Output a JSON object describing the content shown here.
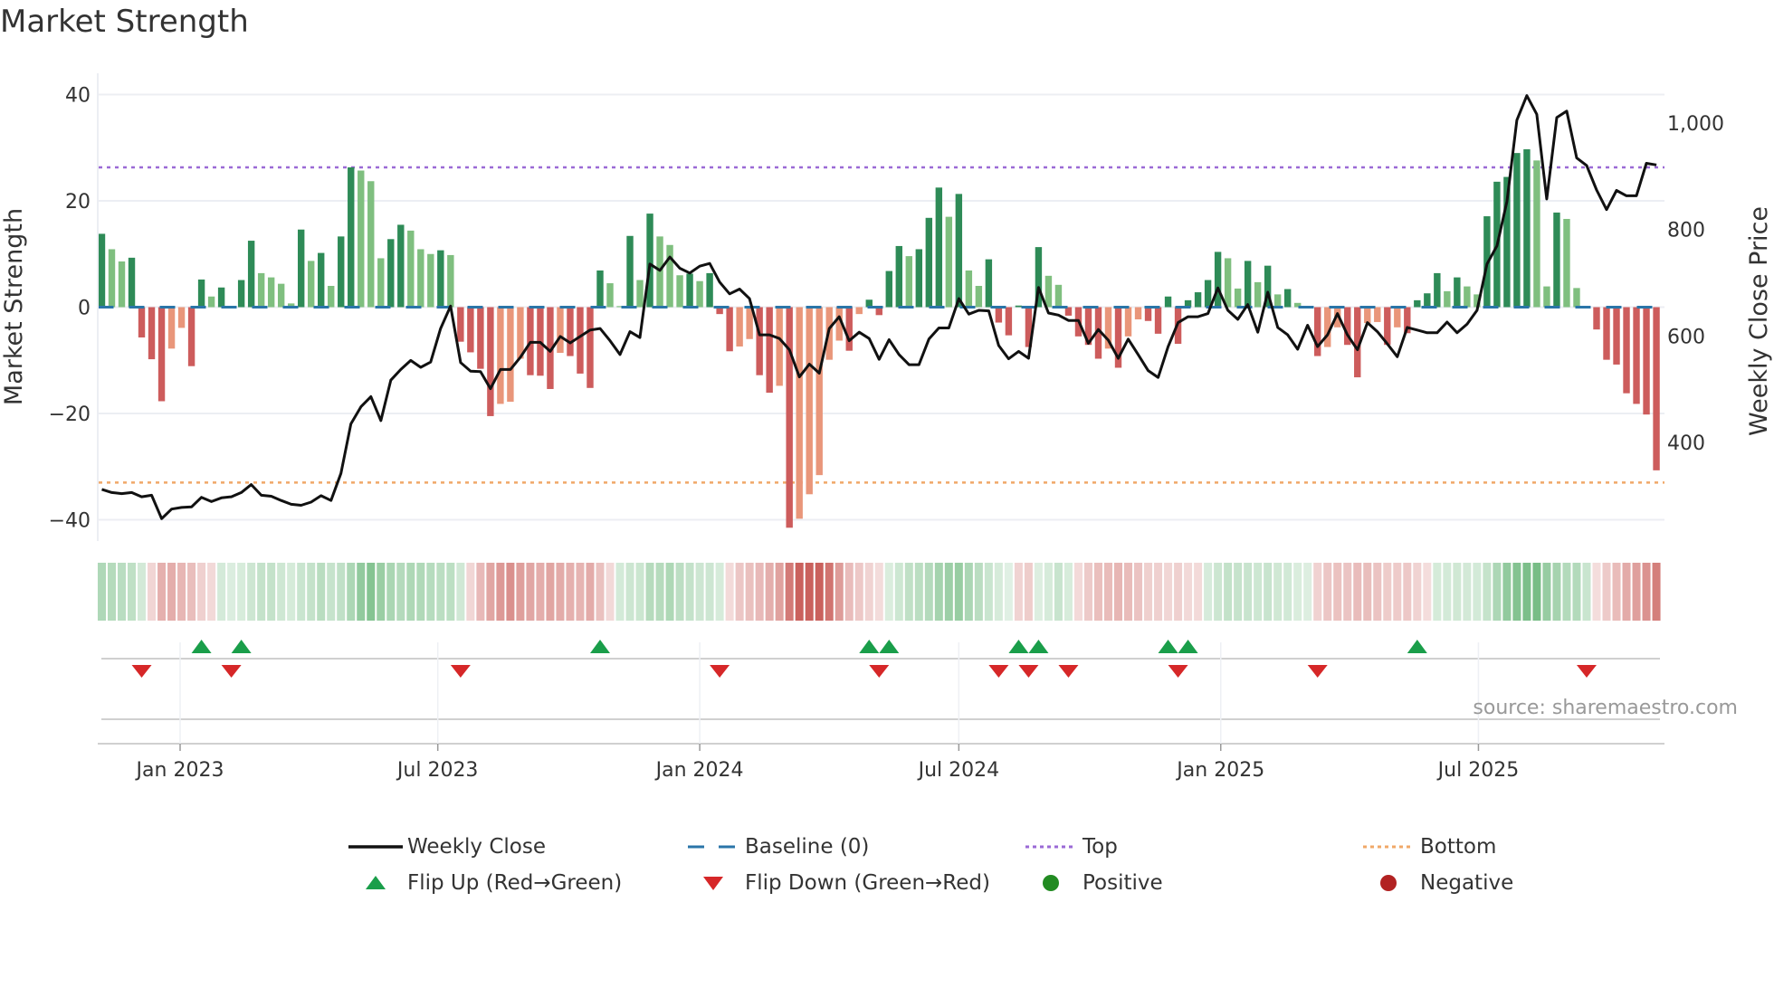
{
  "title": "Market Strength",
  "source": "source: sharemaestro.com",
  "legend": {
    "weekly_close": "Weekly Close",
    "baseline": "Baseline (0)",
    "top": "Top",
    "bottom": "Bottom",
    "flip_up": "Flip Up (Red→Green)",
    "flip_down": "Flip Down (Green→Red)",
    "positive": "Positive",
    "negative": "Negative"
  },
  "colors": {
    "strong_green": "#2e8b57",
    "light_green": "#7fbf7f",
    "strong_red": "#cd5c5c",
    "light_red": "#e9967a",
    "line": "#111111",
    "baseline": "#2a75a8",
    "top": "#9b6ad6",
    "bottom": "#f0a868",
    "flip_up": "#1a9e4a",
    "flip_down": "#d62728",
    "positive": "#228b22",
    "negative": "#b22222"
  },
  "chart_data": {
    "type": "bar+line",
    "title": "Market Strength",
    "ylabel": "Market Strength",
    "y2label": "Weekly Close Price",
    "ylim": [
      -44,
      44
    ],
    "y2lim": [
      215,
      1093
    ],
    "yticks": [
      "40",
      "20",
      "0",
      "−20",
      "−40"
    ],
    "ytick_values": [
      40,
      20,
      0,
      -20,
      -40
    ],
    "y2ticks": [
      "1,000",
      "800",
      "600",
      "400"
    ],
    "y2tick_values": [
      1000,
      800,
      600,
      400
    ],
    "xticks": [
      {
        "label": "Jan 2023",
        "date": "2023-01-01"
      },
      {
        "label": "Jul 2023",
        "date": "2023-07-01"
      },
      {
        "label": "Jan 2024",
        "date": "2024-01-01"
      },
      {
        "label": "Jul 2024",
        "date": "2024-07-01"
      },
      {
        "label": "Jan 2025",
        "date": "2025-01-01"
      },
      {
        "label": "Jul 2025",
        "date": "2025-07-01"
      }
    ],
    "first_week": "2022-11-07",
    "interval_days": 7,
    "top_level": 26.3,
    "bottom_level": -33,
    "strength": [
      13.8,
      10.9,
      8.6,
      9.3,
      -5.7,
      -9.8,
      -17.7,
      -7.8,
      -3.9,
      -11.1,
      5.2,
      2.0,
      3.7,
      0,
      5.1,
      12.5,
      6.4,
      5.6,
      4.4,
      0.7,
      14.6,
      8.7,
      10.2,
      4.0,
      13.3,
      26.3,
      25.7,
      23.7,
      9.2,
      12.8,
      15.5,
      14.4,
      10.9,
      10.0,
      10.7,
      9.8,
      -6.5,
      -8.5,
      -11.6,
      -20.5,
      -18.2,
      -17.8,
      -9.7,
      -12.8,
      -12.9,
      -15.4,
      -8.6,
      -9.2,
      -12.5,
      -15.2,
      6.9,
      4.5,
      0.2,
      13.4,
      5.1,
      17.6,
      13.3,
      11.7,
      6.0,
      6.3,
      4.9,
      6.4,
      -1.3,
      -8.3,
      -7.4,
      -6.0,
      -12.8,
      -16.1,
      -14.8,
      -41.5,
      -39.8,
      -35.2,
      -31.6,
      -9.9,
      -6.3,
      -8.2,
      -1.3,
      1.4,
      -1.5,
      6.8,
      11.5,
      9.6,
      10.9,
      16.8,
      22.5,
      17.0,
      21.3,
      6.9,
      4.0,
      9.0,
      -2.9,
      -5.3,
      0.3,
      -7.5,
      11.3,
      5.9,
      4.2,
      -1.6,
      -5.5,
      -7.1,
      -9.7,
      -7.8,
      -11.4,
      -5.5,
      -2.3,
      -2.6,
      -5.0,
      2.0,
      -6.9,
      1.3,
      2.8,
      5.1,
      10.4,
      9.2,
      3.5,
      8.7,
      4.7,
      7.8,
      2.4,
      3.4,
      0.8,
      0,
      -9.2,
      -7.5,
      -3.8,
      -7.1,
      -13.2,
      -3.0,
      -2.8,
      -7.1,
      -3.8,
      -4.9,
      1.3,
      2.6,
      6.4,
      3.0,
      5.6,
      3.9,
      2.4,
      17.1,
      23.6,
      24.5,
      29.0,
      29.7,
      27.6,
      3.9,
      17.8,
      16.6,
      3.6,
      0,
      -4.2,
      -9.9,
      -10.8,
      -16.2,
      -18.2,
      -20.2,
      -30.7
    ],
    "weekly_close": [
      312,
      306,
      304,
      306,
      298,
      301,
      257,
      275,
      278,
      279,
      297,
      289,
      296,
      298,
      306,
      321,
      301,
      299,
      291,
      284,
      282,
      288,
      300,
      291,
      342,
      435,
      467,
      486,
      441,
      517,
      537,
      554,
      541,
      551,
      614,
      656,
      550,
      534,
      533,
      501,
      537,
      537,
      560,
      588,
      588,
      571,
      599,
      587,
      599,
      611,
      614,
      591,
      565,
      608,
      597,
      735,
      723,
      748,
      727,
      718,
      731,
      736,
      701,
      679,
      688,
      670,
      602,
      602,
      595,
      574,
      523,
      547,
      530,
      614,
      636,
      591,
      607,
      595,
      556,
      593,
      565,
      546,
      546,
      594,
      615,
      615,
      670,
      641,
      648,
      647,
      582,
      557,
      571,
      558,
      691,
      643,
      639,
      629,
      629,
      586,
      612,
      592,
      558,
      594,
      565,
      535,
      522,
      580,
      625,
      636,
      636,
      642,
      690,
      648,
      631,
      659,
      607,
      682,
      616,
      602,
      575,
      620,
      580,
      602,
      642,
      602,
      574,
      625,
      608,
      585,
      561,
      616,
      611,
      606,
      606,
      626,
      606,
      622,
      648,
      735,
      769,
      852,
      1005,
      1051,
      1016,
      857,
      1010,
      1022,
      934,
      920,
      874,
      837,
      873,
      863,
      863,
      924,
      921
    ],
    "flip_up_weeks": [
      11,
      15,
      51,
      78,
      80,
      93,
      95,
      108,
      110,
      133
    ],
    "flip_down_weeks": [
      5,
      14,
      37,
      63,
      79,
      91,
      94,
      98,
      109,
      123,
      150
    ]
  }
}
